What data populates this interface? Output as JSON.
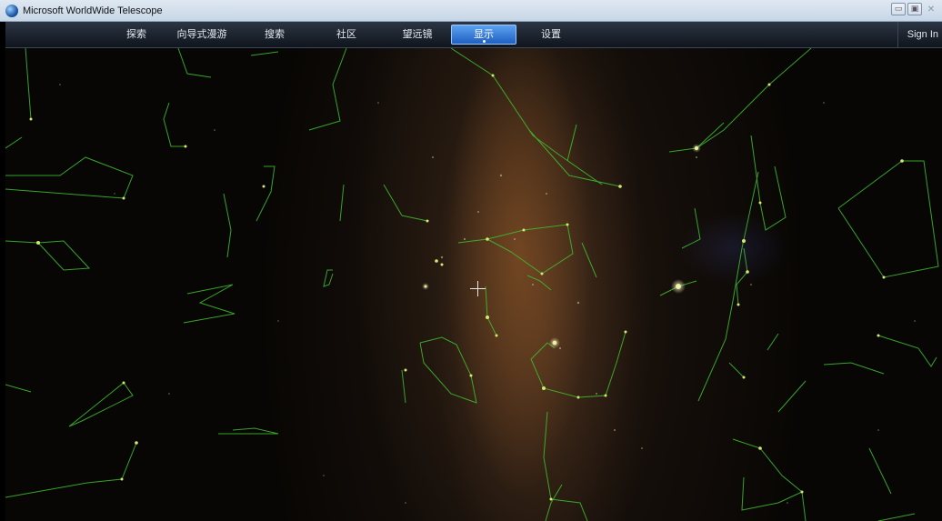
{
  "window": {
    "title": "Microsoft WorldWide Telescope",
    "controls": {
      "minimize": "▭",
      "restore": "▣",
      "close": "✕"
    }
  },
  "menu": {
    "items": [
      {
        "label": "探索",
        "active": false
      },
      {
        "label": "向导式漫游",
        "active": false
      },
      {
        "label": "搜索",
        "active": false
      },
      {
        "label": "社区",
        "active": false
      },
      {
        "label": "望远镜",
        "active": false
      },
      {
        "label": "显示",
        "active": true
      },
      {
        "label": "设置",
        "active": false
      }
    ],
    "sign_in": "Sign In"
  },
  "colors": {
    "constellation_line": "#3fbf2f",
    "star_highlight": "#d8e86a",
    "active_tab": "#3a7fe0"
  }
}
